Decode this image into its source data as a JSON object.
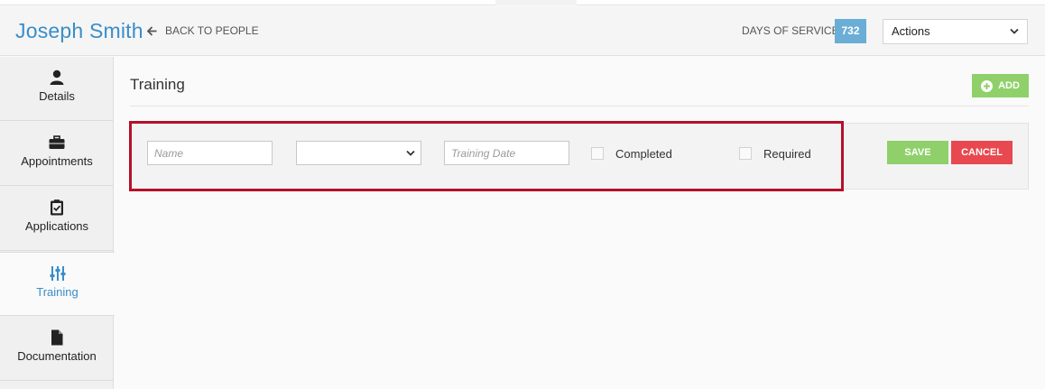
{
  "header": {
    "person_name": "Joseph Smith",
    "back_label": "BACK TO PEOPLE",
    "days_of_service_label": "DAYS OF SERVICE",
    "days_of_service_value": "732",
    "actions_label": "Actions"
  },
  "sidebar": {
    "items": [
      {
        "label": "Details",
        "icon": "user-icon"
      },
      {
        "label": "Appointments",
        "icon": "briefcase-icon"
      },
      {
        "label": "Applications",
        "icon": "clipboard-check-icon"
      },
      {
        "label": "Training",
        "icon": "sliders-icon",
        "active": true
      },
      {
        "label": "Documentation",
        "icon": "file-icon"
      }
    ]
  },
  "main": {
    "title": "Training",
    "add_label": "ADD",
    "form": {
      "name_placeholder": "Name",
      "type_value": "",
      "date_placeholder": "Training Date",
      "completed_label": "Completed",
      "required_label": "Required",
      "save_label": "SAVE",
      "cancel_label": "CANCEL"
    }
  },
  "colors": {
    "accent_blue": "#3a8dc9",
    "badge_blue": "#6aaed6",
    "green": "#8fd06a",
    "red": "#e8484f",
    "highlight": "#b5102a"
  }
}
